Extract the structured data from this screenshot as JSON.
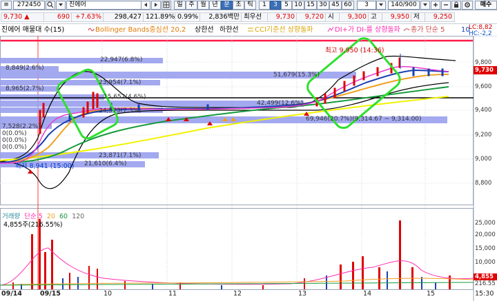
{
  "toolbar": {
    "menu_icon": "≡",
    "code": "272450",
    "name": "진에어",
    "period_buttons": [
      "일",
      "주",
      "월",
      "년",
      "분",
      "초",
      "틱"
    ],
    "interval_buttons": [
      "1",
      "3",
      "5",
      "10",
      "15",
      "30",
      "45",
      "60"
    ],
    "selected_interval": "3",
    "minute_value": "3",
    "count": "140/900",
    "right_button": "매수"
  },
  "quote": {
    "price": "9,730",
    "change_arrow": "▲",
    "change": "690",
    "change_pct": "+7.63%",
    "volume": "298,427",
    "vol_ratio": "121.89%",
    "turnover_ratio": "0.99%",
    "amount": "2,836백만",
    "best_label": "최우선",
    "ask": "9,730",
    "bid": "9,720",
    "open_label": "시",
    "open": "9,300",
    "high_label": "고",
    "high": "9,950",
    "low_label": "저",
    "low": "9,250"
  },
  "legend": {
    "title": "진에어 매물대 수(15)",
    "bollinger": "Bollinger Bands중심선 20,2",
    "upper": "상한선",
    "lower": "하한선",
    "cci": "CCI기준선 상향돌파",
    "dmi": "DI+가 DI-를 상향돌파",
    "ma": "종가 단순 5",
    "ma_val": "10",
    "right_top": "LC:8,82",
    "right_bottom": "HC:-2,2"
  },
  "price_chart": {
    "price_axis": [
      "9,800",
      "9,730",
      "9,600",
      "9,400",
      "9,200",
      "9,000",
      "8,800"
    ],
    "current_price": "9,730",
    "volume_profile": [
      {
        "label": "22,947(6.8%)"
      },
      {
        "label": "8,849(2.6%)"
      },
      {
        "label": "51,679(15.3%)"
      },
      {
        "label": "23,954(7.1%)"
      },
      {
        "label": "8,965(2.7%)"
      },
      {
        "label": "15,652(4.6%)"
      },
      {
        "label": "24,573(7.3%)"
      },
      {
        "label": "42,499(12.6%)"
      },
      {
        "label": "69,946(20.7%)(9,314.67 ~ 9,314.00)"
      },
      {
        "label": "7,528(2.2%)"
      },
      {
        "label": "0(0.0%)"
      },
      {
        "label": "0(0.0%)"
      },
      {
        "label": "0(0.0%)"
      },
      {
        "label": "23,871(7.1%)"
      },
      {
        "label": "21,610(6.4%)"
      }
    ],
    "high_note": "최고 9,950 (14:36)",
    "low_note": "최저 8,941 (15:00)"
  },
  "volume_chart": {
    "legend_name": "거래량",
    "ma_label": "단순 5",
    "ma_periods": [
      "20",
      "60",
      "120"
    ],
    "last_volume": "4,855주(216.55%)",
    "volume_axis": [
      "25,000",
      "20,000",
      "15,000",
      "10,000",
      "5,000"
    ],
    "current_volume": "4,855",
    "current_pct": "216.55"
  },
  "x_axis": [
    "09/14",
    "09/15",
    "10",
    "11",
    "12",
    "13",
    "14",
    "15",
    "15:30"
  ]
}
